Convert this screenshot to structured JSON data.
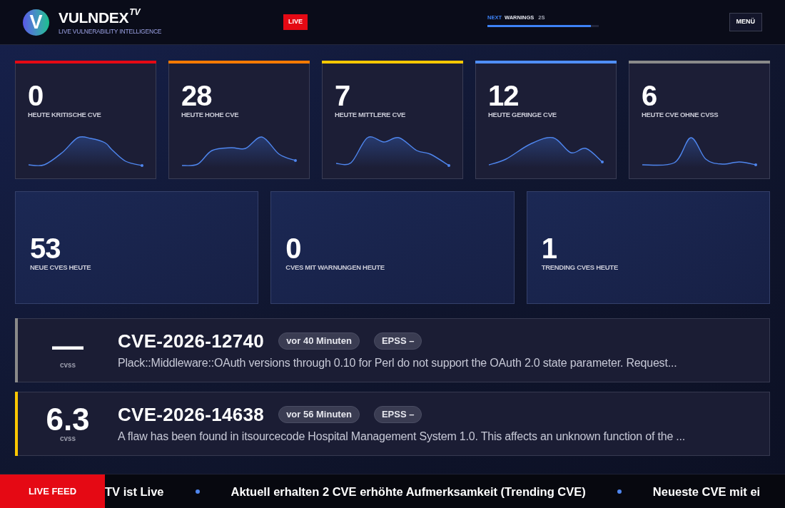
{
  "header": {
    "logo_mark": "V",
    "brand": "VULNDEX",
    "brand_suffix": "TV",
    "tagline": "LIVE VULNERABILITY INTELLIGENCE",
    "live_badge": "LIVE",
    "next_timer": {
      "prefix": "NEXT",
      "label": "WARNINGS",
      "countdown": "2S",
      "level": 0.93
    },
    "menu_button": "MENÜ"
  },
  "severity_cards": [
    {
      "value": "0",
      "label": "HEUTE KRITISCHE CVE",
      "color": "#e50914"
    },
    {
      "value": "28",
      "label": "HEUTE HOHE CVE",
      "color": "#ff7a00"
    },
    {
      "value": "7",
      "label": "HEUTE MITTLERE CVE",
      "color": "#ffc800"
    },
    {
      "value": "12",
      "label": "HEUTE GERINGE CVE",
      "color": "#4f8ef7"
    },
    {
      "value": "6",
      "label": "HEUTE CVE OHNE CVSS",
      "color": "#8a8a8a"
    }
  ],
  "summary_cards": [
    {
      "value": "53",
      "label": "NEUE CVES HEUTE"
    },
    {
      "value": "0",
      "label": "CVES MIT WARNUNGEN HEUTE"
    },
    {
      "value": "1",
      "label": "TRENDING CVES HEUTE"
    }
  ],
  "cve_feed": [
    {
      "score": "—",
      "score_label": "cvss",
      "id": "CVE-2026-12740",
      "age": "vor 40 Minuten",
      "epss": "EPSS –",
      "description": "Plack::Middleware::OAuth versions through 0.10 for Perl do not support the OAuth 2.0 state parameter. Request...",
      "color": "#8a8a8a"
    },
    {
      "score": "6.3",
      "score_label": "cvss",
      "id": "CVE-2026-14638",
      "age": "vor 56 Minuten",
      "epss": "EPSS –",
      "description": "A flaw has been found in itsourcecode Hospital Management System 1.0. This affects an unknown function of the ...",
      "color": "#ffc800"
    }
  ],
  "ticker": {
    "label": "LIVE FEED",
    "items": [
      "TV ist Live",
      "Aktuell erhalten 2 CVE erhöhte Aufmerksamkeit (Trending CVE)",
      "Neueste CVE mit ei"
    ]
  }
}
